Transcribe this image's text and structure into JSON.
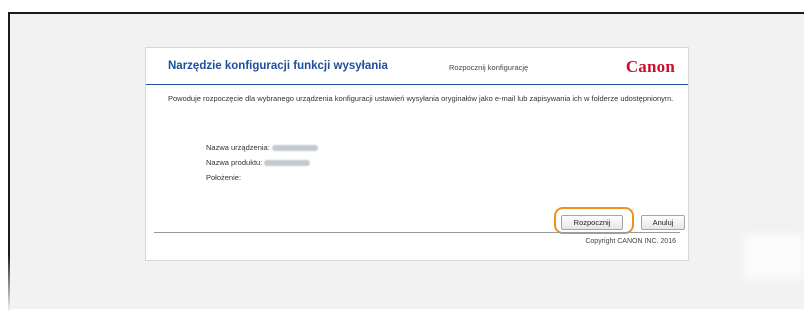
{
  "dialog": {
    "title": "Narzędzie konfiguracji funkcji wysyłania",
    "subtitle": "Rozpocznij konfigurację",
    "logo": "Canon",
    "description": "Powoduje rozpoczęcie dla wybranego urządzenia konfiguracji ustawień wysyłania oryginałów jako e-mail lub zapisywania ich w folderze udostępnionym.",
    "info": {
      "device_name_label": "Nazwa urządzenia:",
      "product_name_label": "Nazwa produktu:",
      "location_label": "Położenie:"
    },
    "buttons": {
      "start_label": "Rozpocznij",
      "cancel_label": "Anuluj"
    },
    "copyright": "Copyright CANON INC. 2016"
  },
  "colors": {
    "title": "#1f4e9a",
    "logo": "#c8102e",
    "highlight": "#f0911c"
  }
}
